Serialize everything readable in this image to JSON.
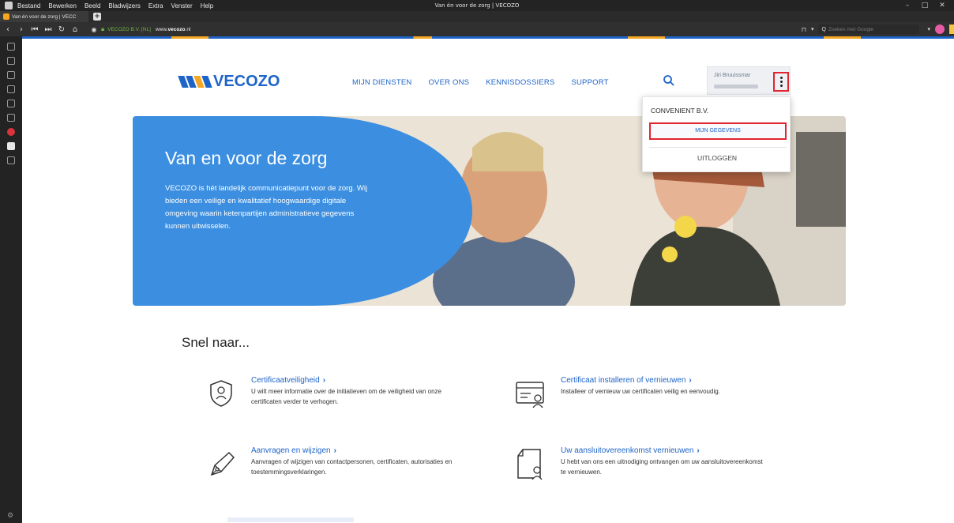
{
  "browser": {
    "menu": [
      "Bestand",
      "Bewerken",
      "Beeld",
      "Bladwijzers",
      "Extra",
      "Venster",
      "Help"
    ],
    "window_title": "Van én voor de zorg | VECOZO",
    "tab_title": "Van én voor de zorg | VECC",
    "site_identity": "VECOZO B.V. [NL]",
    "url_prefix": "www.",
    "url_domain": "vecozo",
    "url_suffix": ".nl",
    "search_placeholder": "Zoeken met Google"
  },
  "site": {
    "logo_text": "VECOZO",
    "logo_colors": [
      "#1e64c8",
      "#1e64c8",
      "#f5a623",
      "#1e64c8"
    ],
    "nav": [
      "MIJN DIENSTEN",
      "OVER ONS",
      "KENNISDOSSIERS",
      "SUPPORT"
    ],
    "user_name": "Jiri Bruuissmar",
    "dropdown": {
      "organization": "CONVENIENT B.V.",
      "mijn_gegevens": "MIJN GEGEVENS",
      "logout": "UITLOGGEN"
    },
    "hero": {
      "title": "Van en voor de zorg",
      "text": "VECOZO is hét landelijk communicatiepunt voor de zorg. Wij bieden een veilige en kwalitatief hoogwaardige digitale omgeving waarin ketenpartijen administratieve gegevens kunnen uitwisselen."
    },
    "snel_naar": "Snel naar...",
    "cards": [
      {
        "title": "Certificaatveiligheid",
        "desc": "U wilt meer informatie over de initiatieven om de veiligheid van onze certificaten verder te verhogen.",
        "icon": "shield-person-icon"
      },
      {
        "title": "Certificaat installeren of vernieuwen",
        "desc": "Installeer of vernieuw uw certificaten veilig en eenvoudig.",
        "icon": "certificate-icon"
      },
      {
        "title": "Aanvragen en wijzigen",
        "desc": "Aanvragen of wijzigen van contactpersonen, certificaten, autorisaties en toestemmingsverklaringen.",
        "icon": "pen-icon"
      },
      {
        "title": "Uw aansluitovereenkomst vernieuwen",
        "desc": "U hebt van ons een uitnodiging ontvangen om uw aansluitovereenkomst te vernieuwen.",
        "icon": "document-person-icon"
      }
    ],
    "colors": {
      "brand_blue": "#1e64c8",
      "hero_blue": "#3b8ee0",
      "accent_orange": "#f5a623",
      "highlight_red": "#e0252f"
    }
  }
}
